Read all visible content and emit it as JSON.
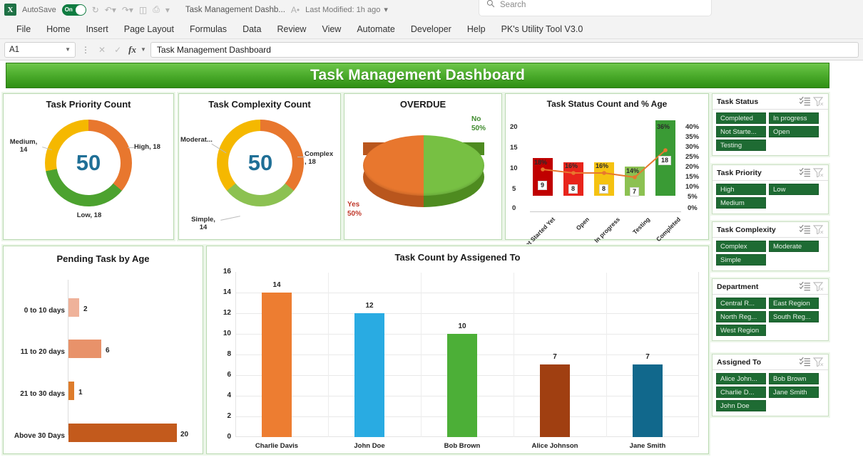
{
  "titlebar": {
    "autosave_label": "AutoSave",
    "toggle_state": "On",
    "doc_name": "Task Management Dashb...",
    "modified": "Last Modified: 1h ago",
    "search_placeholder": "Search",
    "logo_letter": "X"
  },
  "ribbon": {
    "tabs": [
      "File",
      "Home",
      "Insert",
      "Page Layout",
      "Formulas",
      "Data",
      "Review",
      "View",
      "Automate",
      "Developer",
      "Help",
      "PK's Utility Tool V3.0"
    ]
  },
  "formula_bar": {
    "name_box": "A1",
    "fx_label": "fx",
    "content": "Task Management Dashboard"
  },
  "dashboard": {
    "banner_title": "Task Management Dashboard"
  },
  "chart_data": [
    {
      "type": "pie",
      "title": "Task Priority Count",
      "center_total": "50",
      "categories": [
        "High",
        "Medium",
        "Low"
      ],
      "values": [
        18,
        14,
        18
      ],
      "labels": [
        "High, 18",
        "Medium,\n14",
        "Low, 18"
      ],
      "label_high": "High, 18",
      "label_medium_l1": "Medium,",
      "label_medium_l2": "14",
      "label_low": "Low, 18",
      "colors": [
        "#E8772E",
        "#F5B800",
        "#4CA22F"
      ]
    },
    {
      "type": "pie",
      "title": "Task Complexity Count",
      "center_total": "50",
      "categories": [
        "Complex",
        "Moderate",
        "Simple"
      ],
      "values": [
        18,
        18,
        14
      ],
      "label_complex_l1": "Complex",
      "label_complex_l2": ", 18",
      "label_moderate": "Moderat...",
      "label_simple_l1": "Simple,",
      "label_simple_l2": "14",
      "colors": [
        "#E8772E",
        "#F5B800",
        "#8CC152"
      ]
    },
    {
      "type": "pie",
      "title": "OVERDUE",
      "categories": [
        "Yes",
        "No"
      ],
      "values": [
        50,
        50
      ],
      "label_yes_l1": "Yes",
      "label_yes_l2": "50%",
      "label_no_l1": "No",
      "label_no_l2": "50%",
      "colors": [
        "#E8772E",
        "#77C043"
      ]
    },
    {
      "type": "bar",
      "title": "Task Status Count and % Age",
      "categories": [
        "Not Started Yet",
        "Open",
        "In progress",
        "Testing",
        "Completed"
      ],
      "values": [
        9,
        8,
        8,
        7,
        18
      ],
      "series": [
        {
          "name": "Count",
          "values": [
            9,
            8,
            8,
            7,
            18
          ]
        },
        {
          "name": "% Age",
          "values": [
            18,
            16,
            16,
            14,
            36
          ]
        }
      ],
      "pct_labels": [
        "18%",
        "16%",
        "16%",
        "14%",
        "36%"
      ],
      "ylim": [
        0,
        20
      ],
      "yticks": [
        "20",
        "15",
        "10",
        "5",
        "0"
      ],
      "y2lim": [
        0,
        40
      ],
      "y2ticks": [
        "40%",
        "35%",
        "30%",
        "25%",
        "20%",
        "15%",
        "10%",
        "5%",
        "0%"
      ],
      "bar_colors": [
        "#C00000",
        "#E8241B",
        "#F5C211",
        "#8CC152",
        "#3A9B35"
      ],
      "line_color": "#E8772E"
    },
    {
      "type": "bar",
      "title": "Pending Task by Age",
      "orientation": "horizontal",
      "categories": [
        "0 to 10 days",
        "11 to 20 days",
        "21 to 30 days",
        "Above 30 Days"
      ],
      "values": [
        2,
        6,
        1,
        20
      ],
      "colors": [
        "#EFB29A",
        "#E8926A",
        "#DE7C2B",
        "#C35A1C"
      ]
    },
    {
      "type": "bar",
      "title": "Task Count by Assigened To",
      "categories": [
        "Charlie Davis",
        "John Doe",
        "Bob Brown",
        "Alice Johnson",
        "Jane Smith"
      ],
      "values": [
        14,
        12,
        10,
        7,
        7
      ],
      "ylim": [
        0,
        16
      ],
      "yticks": [
        "16",
        "14",
        "12",
        "10",
        "8",
        "6",
        "4",
        "2",
        "0"
      ],
      "colors": [
        "#ED7D31",
        "#29ABE2",
        "#4CAF37",
        "#A03F11",
        "#11688C"
      ]
    }
  ],
  "slicers": [
    {
      "title": "Task Status",
      "items": [
        "Completed",
        "In progress",
        "Not Starte...",
        "Open",
        "Testing"
      ]
    },
    {
      "title": "Task Priority",
      "items": [
        "High",
        "Low",
        "Medium"
      ]
    },
    {
      "title": "Task Complexity",
      "items": [
        "Complex",
        "Moderate",
        "Simple"
      ]
    },
    {
      "title": "Department",
      "items": [
        "Central R...",
        "East Region",
        "North Reg...",
        "South Reg...",
        "West Region"
      ]
    },
    {
      "title": "Assigned To",
      "items": [
        "Alice John...",
        "Bob Brown",
        "Charlie D...",
        "Jane Smith",
        "John Doe"
      ]
    }
  ]
}
